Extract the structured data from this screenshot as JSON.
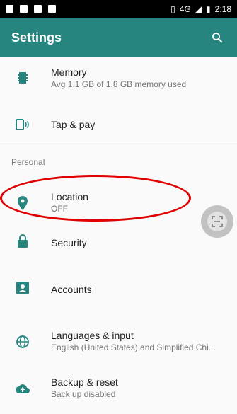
{
  "status_bar": {
    "network": "4G",
    "time": "2:18"
  },
  "app_bar": {
    "title": "Settings"
  },
  "items": {
    "memory": {
      "title": "Memory",
      "subtitle": "Avg 1.1 GB of 1.8 GB memory used"
    },
    "tap_pay": {
      "title": "Tap & pay"
    },
    "section": "Personal",
    "location": {
      "title": "Location",
      "subtitle": "OFF"
    },
    "security": {
      "title": "Security"
    },
    "accounts": {
      "title": "Accounts"
    },
    "languages": {
      "title": "Languages & input",
      "subtitle": "English (United States) and Simplified Chi..."
    },
    "backup": {
      "title": "Backup & reset",
      "subtitle": "Back up disabled"
    }
  },
  "colors": {
    "accent": "#26857f",
    "highlight": "#e00000"
  }
}
